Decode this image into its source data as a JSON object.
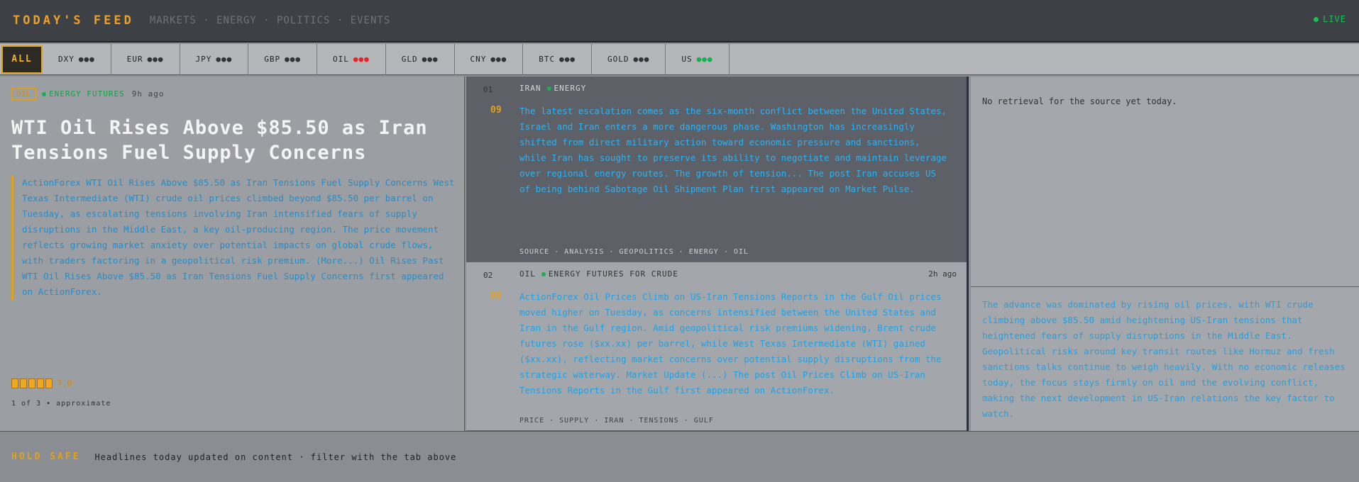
{
  "header": {
    "brand": "TODAY'S FEED",
    "tagline": "MARKETS · ENERGY · POLITICS · EVENTS",
    "live": "LIVE"
  },
  "tickers": [
    {
      "label": "ALL",
      "active": true
    },
    {
      "label": "DXY",
      "dots": "●●●",
      "color": "neutral"
    },
    {
      "label": "EUR",
      "dots": "●●●",
      "color": "neutral"
    },
    {
      "label": "JPY",
      "dots": "●●●",
      "color": "neutral"
    },
    {
      "label": "GBP",
      "dots": "●●●",
      "color": "neutral"
    },
    {
      "label": "OIL",
      "dots": "●●●",
      "color": "red"
    },
    {
      "label": "GLD",
      "dots": "●●●",
      "color": "neutral"
    },
    {
      "label": "CNY",
      "dots": "●●●",
      "color": "neutral"
    },
    {
      "label": "BTC",
      "dots": "●●●",
      "color": "neutral"
    },
    {
      "label": "GOLD",
      "dots": "●●●",
      "color": "neutral"
    },
    {
      "label": "US",
      "dots": "●●●",
      "color": "green"
    }
  ],
  "lead": {
    "badge": "OIL",
    "source": "ENERGY FUTURES",
    "time": "9h ago",
    "headline": "WTI Oil Rises Above $85.50 as Iran Tensions Fuel Supply Concerns",
    "body": "ActionForex WTI Oil Rises Above $85.50 as Iran Tensions Fuel Supply Concerns West Texas Intermediate (WTI) crude oil prices climbed beyond $85.50 per barrel on Tuesday, as escalating tensions involving Iran intensified fears of supply disruptions in the Middle East, a key oil-producing region. The price movement reflects growing market anxiety over potential impacts on global crude flows, with traders factoring in a geopolitical risk premium. (More...) Oil Rises Past WTI Oil Rises Above $85.50 as Iran Tensions Fuel Supply Concerns first appeared on ActionForex.",
    "score": "7.0",
    "footnote": "1 of 3 • approximate"
  },
  "cards": [
    {
      "rank": "01",
      "num": "09",
      "category": "IRAN",
      "source": "ENERGY",
      "time": "",
      "text": "The latest escalation comes as the six-month conflict between the United States, Israel and Iran enters a more dangerous phase. Washington has increasingly shifted from direct military action toward economic pressure and sanctions, while Iran has sought to preserve its ability to negotiate and maintain leverage over regional energy routes. The growth of tension... The post Iran accuses US of being behind Sabotage Oil Shipment Plan first appeared on Market Pulse.",
      "foot": "SOURCE · ANALYSIS · GEOPOLITICS · ENERGY · OIL"
    },
    {
      "rank": "02",
      "num": "08",
      "category": "OIL",
      "source": "ENERGY FUTURES FOR CRUDE",
      "time": "2h ago",
      "text": "ActionForex Oil Prices Climb on US-Iran Tensions Reports in the Gulf Oil prices moved higher on Tuesday, as concerns intensified between the United States and Iran in the Gulf region. Amid geopolitical risk premiums widening, Brent crude futures rose ($xx.xx) per barrel, while West Texas Intermediate (WTI) gained ($xx.xx), reflecting market concerns over potential supply disruptions from the strategic waterway. Market Update (...) The post Oil Prices Climb on US-Iran Tensions Reports in the Gulf first appeared on ActionForex.",
      "foot": "PRICE · SUPPLY · IRAN · TENSIONS · GULF"
    }
  ],
  "aside": {
    "top": "No retrieval for the source yet today.",
    "bottom": "The advance was dominated by rising oil prices, with WTI crude climbing above $85.50 amid heightening US-Iran tensions that heightened fears of supply disruptions in the Middle East. Geopolitical risks around key transit routes like Hormuz and fresh sanctions talks continue to weigh heavily. With no economic releases today, the focus stays firmly on oil and the evolving conflict, making the next development in US-Iran relations the key factor to watch."
  },
  "status": {
    "tag": "HOLD SAFE",
    "message": "Headlines today updated on content · filter with the tab above"
  }
}
